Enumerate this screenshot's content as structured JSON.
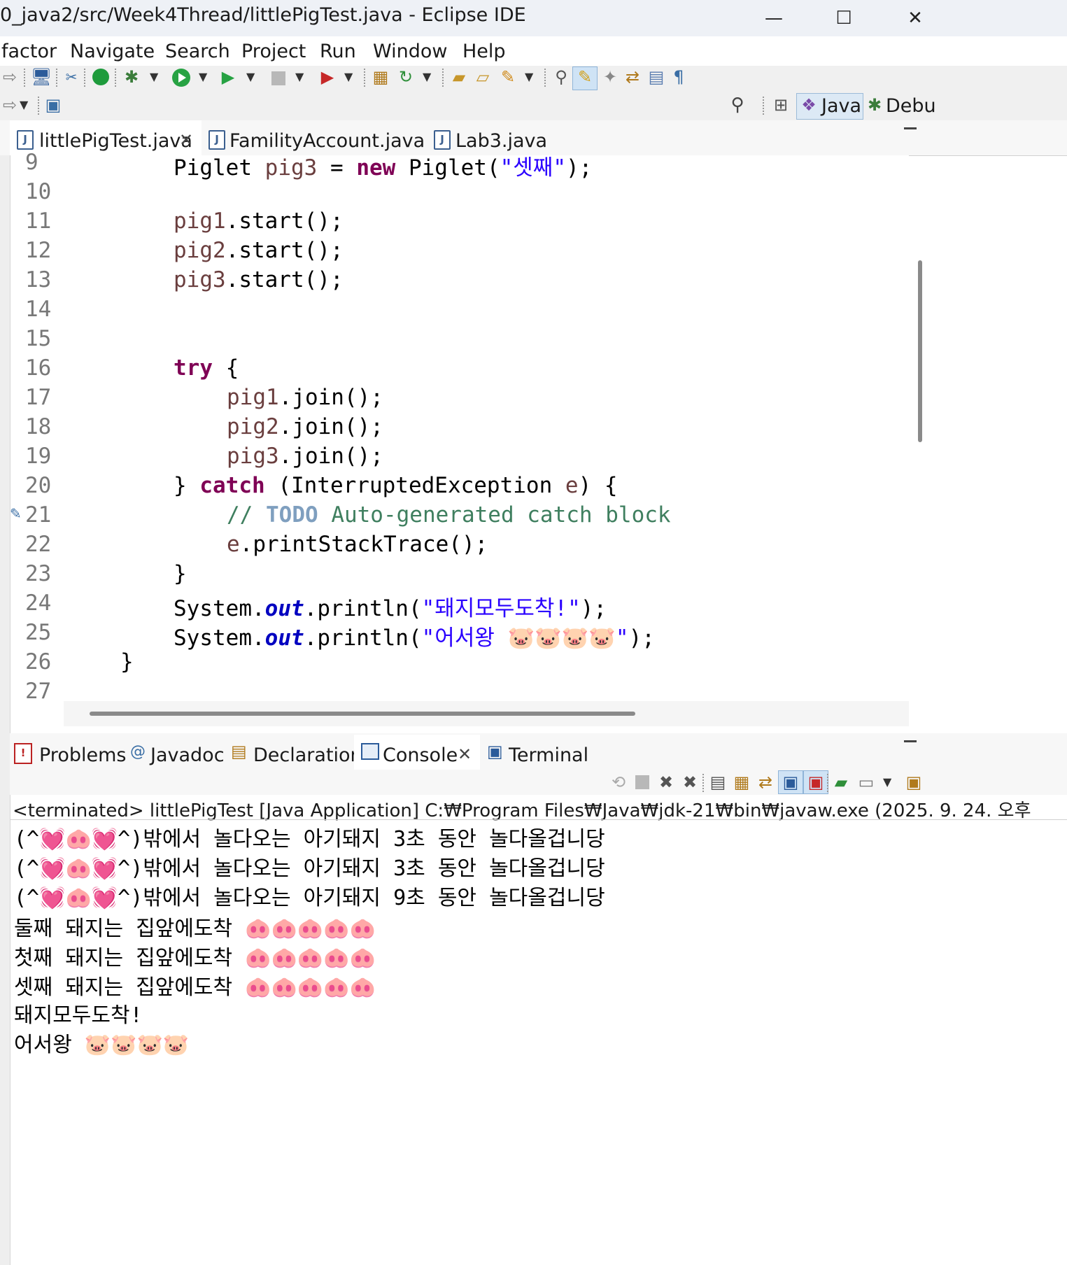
{
  "window": {
    "title": "0_java2/src/Week4Thread/littlePigTest.java - Eclipse IDE",
    "minimize": "—",
    "maximize": "☐",
    "close": "✕"
  },
  "menu": [
    "factor",
    "Navigate",
    "Search",
    "Project",
    "Run",
    "Window",
    "Help"
  ],
  "toolbar": {
    "perspectives": [
      {
        "label": "Java",
        "icon": "java-perspective-icon"
      },
      {
        "label": "Debu",
        "icon": "debug-perspective-icon"
      }
    ],
    "icons": [
      "redo-icon",
      "desktop-icon",
      "tools-icon",
      "power-icon",
      "debug-bug-icon",
      "run-icon",
      "run-coverage-icon",
      "stop-icon",
      "external-tools-icon",
      "new-package-icon",
      "refresh-icon",
      "open-type-icon",
      "open-folder-icon",
      "brush-icon",
      "search-help-icon",
      "highlight-icon",
      "mark-occurrences-icon",
      "compare-icon",
      "whitespace-icon",
      "pilcrow-icon",
      "search-icon",
      "open-perspective-icon"
    ]
  },
  "editor_tabs": [
    {
      "label": "littlePigTest.java",
      "active": true,
      "closable": true
    },
    {
      "label": "FamilityAccount.java",
      "active": false,
      "closable": false
    },
    {
      "label": "Lab3.java",
      "active": false,
      "closable": false
    }
  ],
  "editor": {
    "line_numbers": [
      "9",
      "10",
      "11",
      "12",
      "13",
      "14",
      "15",
      "16",
      "17",
      "18",
      "19",
      "20",
      "21",
      "22",
      "23",
      "24",
      "25",
      "26",
      "27"
    ],
    "lines": {
      "l9": {
        "t1": "Piglet ",
        "v": "pig3",
        "t2": " = ",
        "kw": "new",
        "t3": " Piglet(",
        "s": "\"셋째\"",
        "t4": ");"
      },
      "l11": {
        "v": "pig1",
        "t": ".start();"
      },
      "l12": {
        "v": "pig2",
        "t": ".start();"
      },
      "l13": {
        "v": "pig3",
        "t": ".start();"
      },
      "l16": {
        "kw": "try",
        "t": " {"
      },
      "l17": {
        "v": "pig1",
        "t": ".join();"
      },
      "l18": {
        "v": "pig2",
        "t": ".join();"
      },
      "l19": {
        "v": "pig3",
        "t": ".join();"
      },
      "l20": {
        "t1": "} ",
        "kw": "catch",
        "t2": " (InterruptedException ",
        "v": "e",
        "t3": ") {"
      },
      "l21": {
        "c1": "// ",
        "todo": "TODO",
        "c2": " Auto-generated catch block"
      },
      "l22": {
        "v": "e",
        "t": ".printStackTrace();"
      },
      "l23": {
        "t": "}"
      },
      "l24": {
        "t1": "System.",
        "f": "out",
        "t2": ".println(",
        "s": "\"돼지모두도착!\"",
        "t3": ");"
      },
      "l25": {
        "t1": "System.",
        "f": "out",
        "t2": ".println(",
        "s": "\"어서왕 🐷🐷🐷🐷\"",
        "t3": ");"
      },
      "l26": {
        "t": "}"
      }
    }
  },
  "bottom_tabs": [
    {
      "label": "Problems",
      "icon": "problems-icon"
    },
    {
      "label": "Javadoc",
      "icon": "javadoc-icon"
    },
    {
      "label": "Declaration",
      "icon": "declaration-icon"
    },
    {
      "label": "Console",
      "icon": "console-icon",
      "active": true,
      "closable": true
    },
    {
      "label": "Terminal",
      "icon": "terminal-icon"
    }
  ],
  "console": {
    "header": "<terminated> littlePigTest [Java Application] C:₩Program Files₩Java₩jdk-21₩bin₩javaw.exe  (2025. 9. 24. 오후",
    "output": [
      "(^💓🐽💓^)밖에서 놀다오는 아기돼지 3초 동안 놀다올겁니당",
      "(^💓🐽💓^)밖에서 놀다오는 아기돼지 3초 동안 놀다올겁니당",
      "(^💓🐽💓^)밖에서 놀다오는 아기돼지 9초 동안 놀다올겁니당",
      "둘째 돼지는 집앞에도착 🐽🐽🐽🐽🐽",
      "첫째 돼지는 집앞에도착 🐽🐽🐽🐽🐽",
      "셋째 돼지는 집앞에도착 🐽🐽🐽🐽🐽",
      "돼지모두도착!",
      "어서왕 🐷🐷🐷🐷"
    ]
  }
}
